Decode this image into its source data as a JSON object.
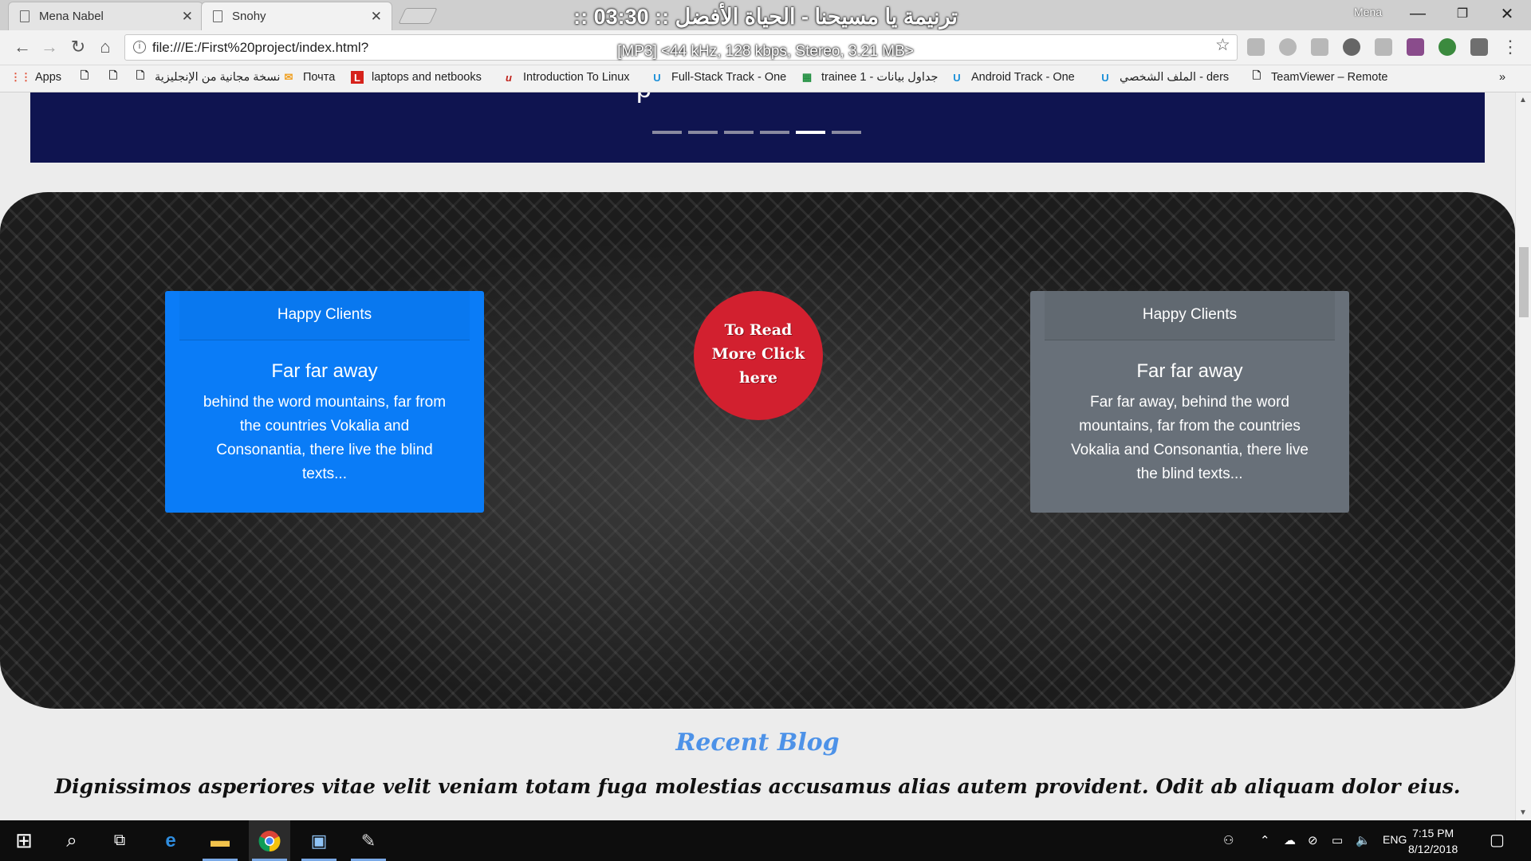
{
  "browser": {
    "tabs": [
      {
        "title": "Mena Nabel",
        "active": false
      },
      {
        "title": "Snohy",
        "active": true
      }
    ],
    "media_overlay": {
      "title": ":: ترنيمة يا مسيحنا - الحياة الأفضل :: 03:30",
      "subtitle": "[MP3] <44 kHz, 128 kbps, Stereo, 3.21 MB>"
    },
    "user": "Mena",
    "url": "file:///E:/First%20project/index.html?",
    "bookmarks": [
      {
        "label": "Apps",
        "icon": "apps-grid-icon"
      },
      {
        "label": "",
        "icon": "page-icon"
      },
      {
        "label": "",
        "icon": "page-icon"
      },
      {
        "label": "نسخة مجانية من الإنجليزية",
        "icon": "page-icon"
      },
      {
        "label": "Почта",
        "icon": "mail-icon"
      },
      {
        "label": "laptops and netbooks",
        "icon": "l-logo-icon"
      },
      {
        "label": "Introduction To Linux",
        "icon": "linux-logo-icon"
      },
      {
        "label": "Full-Stack Track - One",
        "icon": "udacity-icon"
      },
      {
        "label": "trainee 1 - جداول بيانات",
        "icon": "sheets-icon"
      },
      {
        "label": "Android Track - One",
        "icon": "udacity-icon"
      },
      {
        "label": "الملف الشخصي - ders",
        "icon": "udacity-icon"
      },
      {
        "label": "TeamViewer – Remote",
        "icon": "page-icon"
      }
    ],
    "overflow": "»"
  },
  "page": {
    "hero": {
      "text_fragment": "p",
      "slides": 6,
      "active_slide": 5
    },
    "cards": [
      {
        "header": "Happy Clients",
        "title": "Far far away",
        "text": "behind the word mountains, far from the countries Vokalia and Consonantia, there live the blind texts...",
        "color": "#0a7cf7"
      },
      {
        "header": "Happy Clients",
        "title": "Far far away",
        "text": "Far far away, behind the word mountains, far from the countries Vokalia and Consonantia, there live the blind texts...",
        "color": "#687079"
      }
    ],
    "read_more": {
      "line1": "To Read",
      "line2": "More Click",
      "line3": "here",
      "color": "#d2202f"
    },
    "blog": {
      "title": "Recent Blog",
      "subtitle": "Dignissimos asperiores vitae velit veniam totam fuga molestias accusamus alias autem provident. Odit ab aliquam dolor eius."
    }
  },
  "taskbar": {
    "language": "ENG",
    "time": "7:15 PM",
    "date": "8/12/2018"
  }
}
